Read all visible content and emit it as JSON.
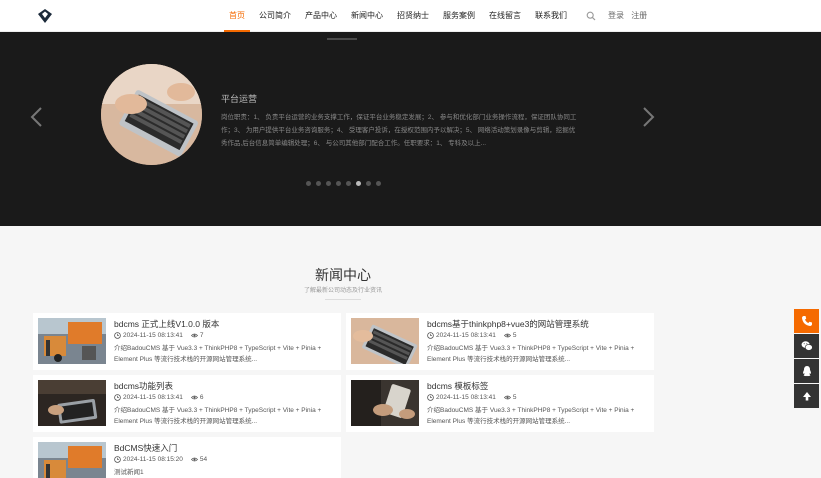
{
  "header": {
    "logo_icon": "diamond-logo-icon",
    "nav": [
      {
        "label": "首页",
        "active": true
      },
      {
        "label": "公司简介"
      },
      {
        "label": "产品中心"
      },
      {
        "label": "新闻中心"
      },
      {
        "label": "招贤纳士"
      },
      {
        "label": "服务案例"
      },
      {
        "label": "在线留言"
      },
      {
        "label": "联系我们"
      }
    ],
    "search_icon": "search-icon",
    "login": "登录",
    "register": "注册"
  },
  "banner": {
    "slide_title": "平台运营",
    "slide_desc": "岗位职责：1、 负责平台运营的业务支撑工作，保证平台业务稳定发展；2、 参与和优化部门业务操作流程，保证团队协同工作；3、 为用户提供平台业务咨询服务；4、 受理客户投诉，在授权范围内予以解决；5、 网络活动策划录像与剪辑，挖掘优秀作品,后台信息简单编辑处理；6、 与公司其他部门配合工作。任职要求：1、 专科及以上...",
    "dot_count": 8,
    "active_dot": 5
  },
  "news": {
    "title": "新闻中心",
    "subtitle": "了解最新公司动态及行业资讯",
    "items": [
      {
        "title": "bdcms 正式上线V1.0.0 版本",
        "date": "2024-11-15 08:13:41",
        "views": "7",
        "desc": "介绍BadouCMS 基于 Vue3.3 + ThinkPHP8 + TypeScript + Vite + Pinia + Element Plus 等流行技术栈的开源网站管理系统..."
      },
      {
        "title": "bdcms基于thinkphp8+vue3的网站管理系统",
        "date": "2024-11-15 08:13:41",
        "views": "5",
        "desc": "介绍BadouCMS 基于 Vue3.3 + ThinkPHP8 + TypeScript + Vite + Pinia + Element Plus 等流行技术栈的开源网站管理系统..."
      },
      {
        "title": "bdcms功能列表",
        "date": "2024-11-15 08:13:41",
        "views": "6",
        "desc": "介绍BadouCMS 基于 Vue3.3 + ThinkPHP8 + TypeScript + Vite + Pinia + Element Plus 等流行技术栈的开源网站管理系统..."
      },
      {
        "title": "bdcms 模板标签",
        "date": "2024-11-15 08:13:41",
        "views": "5",
        "desc": "介绍BadouCMS 基于 Vue3.3 + ThinkPHP8 + TypeScript + Vite + Pinia + Element Plus 等流行技术栈的开源网站管理系统..."
      },
      {
        "title": "BdCMS快速入门",
        "date": "2024-11-15 08:15:20",
        "views": "54",
        "desc": "测试新闻1"
      }
    ]
  },
  "side_tools": [
    "phone-icon",
    "wechat-icon",
    "qq-icon",
    "back-to-top-icon"
  ],
  "colors": {
    "accent": "#f56a00",
    "banner_bg": "#1a1a1a",
    "tool_bg": "#333333"
  }
}
